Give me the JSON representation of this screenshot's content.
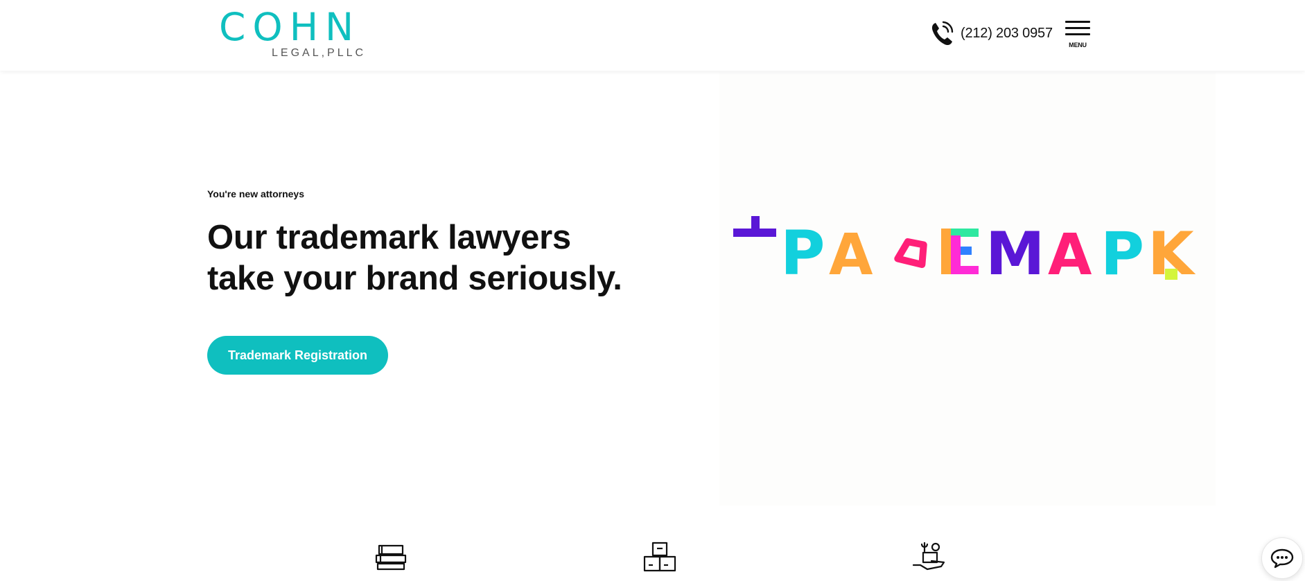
{
  "header": {
    "logo_main": "COHN",
    "logo_sub": "LEGAL,PLLC",
    "phone": "(212) 203 0957",
    "menu_label": "MENU"
  },
  "hero": {
    "eyebrow": "You're new attorneys",
    "headline_line1": "Our trademark lawyers",
    "headline_line2": "take your brand seriously.",
    "cta_label": "Trademark Registration",
    "image_letters": [
      "+",
      "P",
      "A",
      "O",
      "E",
      "M",
      "A",
      "P",
      "K"
    ]
  },
  "features": {
    "icons": [
      "books-icon",
      "boxes-icon",
      "hand-tools-icon"
    ]
  },
  "colors": {
    "brand": "#0fbfbf",
    "text": "#111111",
    "art_purple": "#5a17d6",
    "art_cyan": "#12d0dd",
    "art_orange": "#ffa63a",
    "art_pink": "#ff1f78",
    "art_magenta": "#ff2bd6",
    "art_blue": "#2f80ff",
    "art_green": "#2ee8a0",
    "art_lime": "#d4f53c"
  }
}
